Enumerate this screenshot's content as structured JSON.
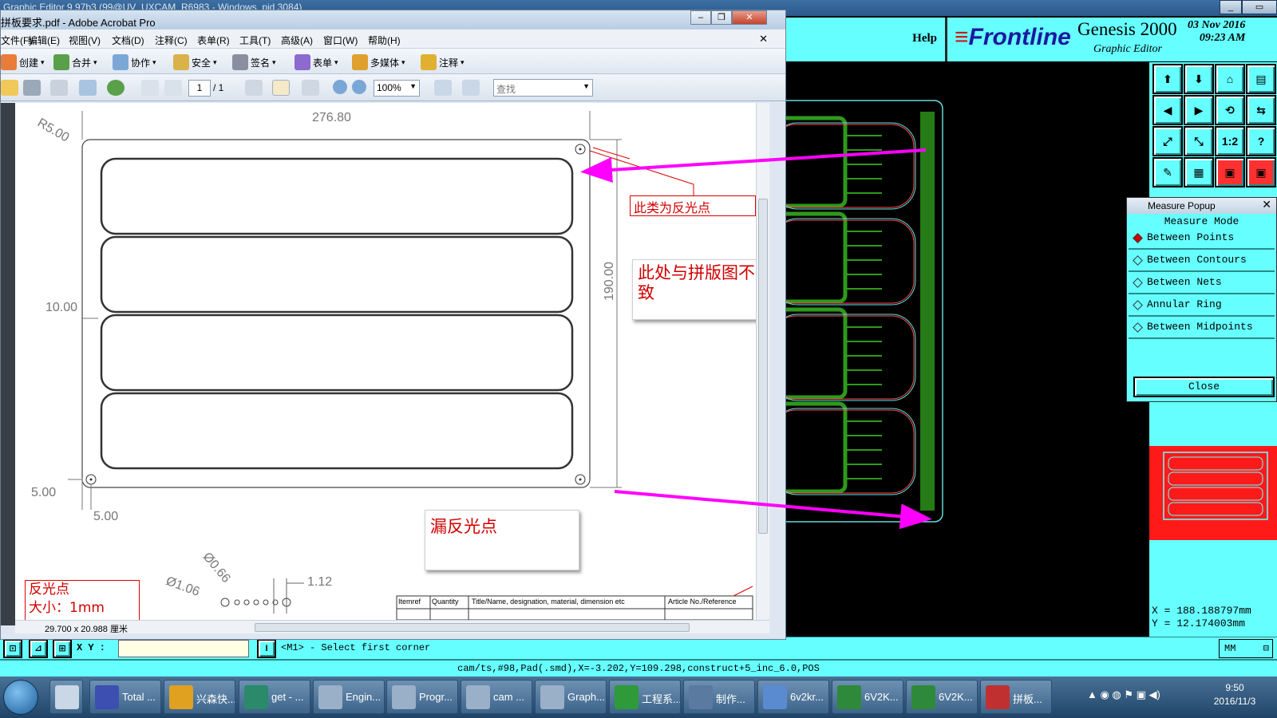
{
  "genesis": {
    "window_title": "Graphic Editor 9.97b3 (99@UV_UXCAM_R6983 - Windows, pid 3084)",
    "help_label": "Help",
    "logo_text": "Frontline",
    "product_title": "Genesis 2000",
    "product_subtitle": "Graphic Editor",
    "date": "03 Nov 2016",
    "time": "09:23 AM",
    "tools": [
      "⬆",
      "⬇",
      "⌂",
      "▤",
      "◀",
      "▶",
      "⟲",
      "⇆",
      "⤢",
      "⤡",
      "1:2",
      "?",
      "✎",
      "▦",
      "▣",
      "▣"
    ],
    "measure_popup": {
      "title": "Measure Popup",
      "mode_header": "Measure Mode",
      "options": [
        {
          "label": "Between Points",
          "selected": true
        },
        {
          "label": "Between Contours",
          "selected": false
        },
        {
          "label": "Between Nets",
          "selected": false
        },
        {
          "label": "Annular Ring",
          "selected": false
        },
        {
          "label": "Between Midpoints",
          "selected": false
        }
      ],
      "close_label": "Close"
    },
    "coord_x": "X = 188.188797mm",
    "coord_y": "Y = 12.174003mm",
    "xy_label": "X Y :",
    "xy_value": "",
    "prompt": "<M1> - Select first corner",
    "units": "MM",
    "status_line": "cam/ts,#98,Pad(.smd),X=-3.202,Y=109.298,construct+5_inc_6.0,POS"
  },
  "acrobat": {
    "title": "拼板要求.pdf - Adobe Acrobat Pro",
    "menus": [
      "文件(F)",
      "编辑(E)",
      "视图(V)",
      "文档(D)",
      "注释(C)",
      "表单(R)",
      "工具(T)",
      "高级(A)",
      "窗口(W)",
      "帮助(H)"
    ],
    "toolbar": [
      "创建",
      "合并",
      "协作",
      "安全",
      "签名",
      "表单",
      "多媒体",
      "注释"
    ],
    "page_current": "1",
    "page_total": "/ 1",
    "zoom": "100%",
    "search_placeholder": "查找",
    "page_size": "29.700 x 20.988 厘米",
    "drawing": {
      "top_dim": "276.80",
      "corner_radius": "R5.00",
      "left_dim": "10.00",
      "right_dim": "190.00",
      "bottom_dim_left": "5.00",
      "bottom_dim_under": "5.00",
      "fid_dia_1": "Ø0.66",
      "fid_dia_2": "Ø1.06",
      "dim_112": "1.12",
      "table_headers": [
        "Itemref",
        "Quantity",
        "Title/Name, designation, material, dimension etc",
        "Article No./Reference"
      ]
    },
    "callouts": {
      "fiducial_type": "此类为反光点",
      "mismatch": "此处与拼版图不一致",
      "missing": "漏反光点",
      "fid_spec_line1": "反光点",
      "fid_spec_line2": "大小：1mm"
    }
  },
  "taskbar": {
    "items": [
      "Total ...",
      "兴森快...",
      "get - ...",
      "Engin...",
      "Progr...",
      "cam ...",
      "Graph...",
      "工程系...",
      "制作...",
      "6v2kr...",
      "6V2K...",
      "6V2K...",
      "拼板..."
    ],
    "time": "9:50",
    "date": "2016/11/3"
  },
  "colors": {
    "genesis_cyan": "#66ffff",
    "annotation_magenta": "#ff00ff",
    "callout_red": "#d00000",
    "pcb_green": "#2e9a1a"
  }
}
